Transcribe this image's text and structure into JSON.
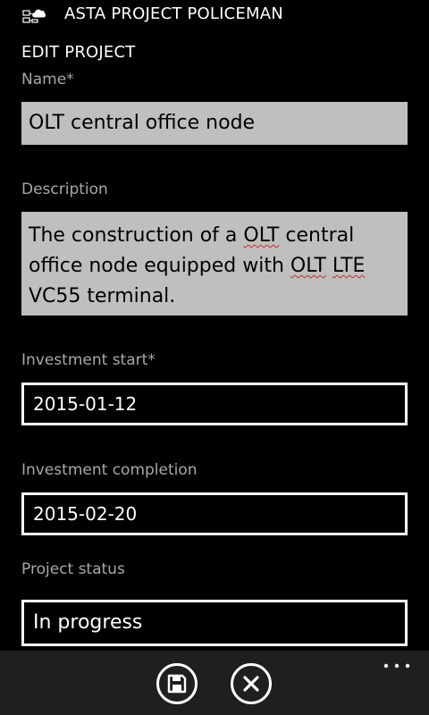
{
  "app": {
    "title": "ASTA PROJECT POLICEMAN",
    "logo_icon": "cloud-network-icon"
  },
  "page": {
    "title": "EDIT PROJECT"
  },
  "form": {
    "name": {
      "label": "Name*",
      "value": "OLT central office node"
    },
    "description": {
      "label": "Description",
      "value_parts": [
        "The construction of a ",
        "OLT",
        " central office node equipped with ",
        "OLT",
        " ",
        "LTE",
        " VC55 terminal."
      ],
      "spellcheck_flagged_words": [
        "OLT",
        "OLT",
        "LTE"
      ]
    },
    "investment_start": {
      "label": "Investment start*",
      "value": "2015-01-12"
    },
    "investment_completion": {
      "label": "Investment completion",
      "value": "2015-02-20"
    },
    "project_status": {
      "label": "Project status",
      "value": "In progress"
    }
  },
  "app_bar": {
    "save_icon": "save-icon",
    "cancel_icon": "close-icon",
    "more_icon": "more-dots-icon"
  },
  "colors": {
    "background": "#000000",
    "app_bar": "#1f1f1f",
    "filled_field": "#bfbfbf",
    "label": "#a8a8a8",
    "spellcheck": "#e02020"
  }
}
